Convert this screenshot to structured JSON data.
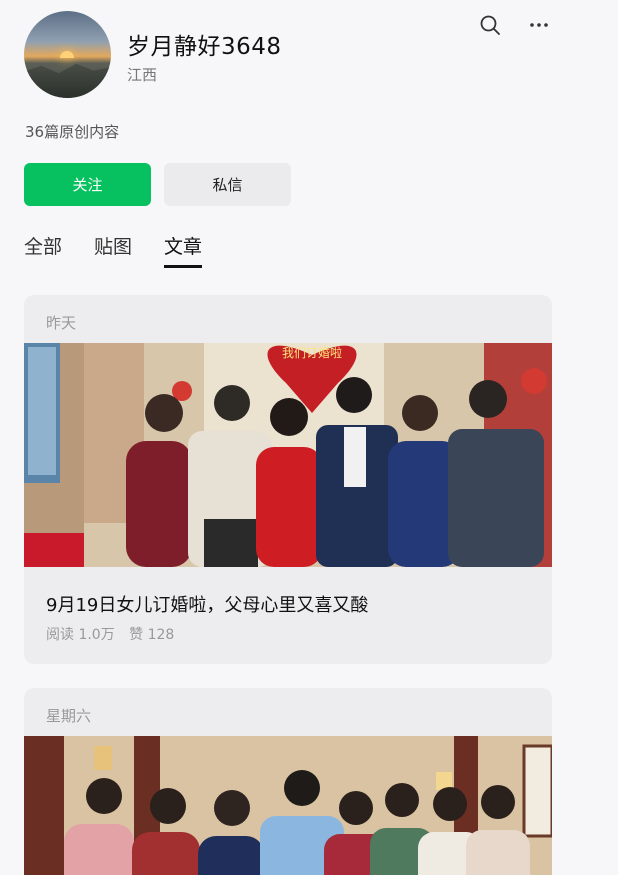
{
  "profile": {
    "name": "岁月静好3648",
    "region": "江西",
    "article_count": "36篇原创内容",
    "avatar_icon": "sunset-mountain-avatar"
  },
  "header": {
    "search_icon": "search-icon",
    "more_icon": "more-dots-icon"
  },
  "actions": {
    "follow_label": "关注",
    "message_label": "私信",
    "follow_color": "#07c160"
  },
  "tabs": [
    {
      "label": "全部"
    },
    {
      "label": "贴图"
    },
    {
      "label": "文章",
      "active": true
    }
  ],
  "articles": [
    {
      "date": "昨天",
      "title": "9月19日女儿订婚啦，父母心里又喜又酸",
      "reads": "阅读 1.0万",
      "likes": "赞 128",
      "image_banner": "我们订婚啦"
    },
    {
      "date": "星期六"
    }
  ]
}
